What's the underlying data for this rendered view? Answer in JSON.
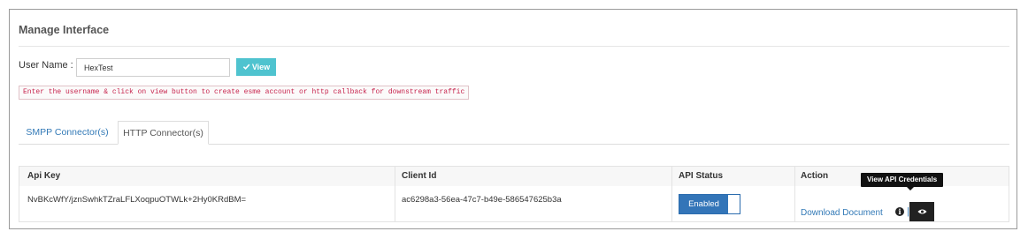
{
  "panel": {
    "title": "Manage Interface"
  },
  "form": {
    "user_label": "User Name :",
    "user_value": "HexTest",
    "view_label": "View",
    "hint": "Enter the username & click on view button to create esme account or http callback for downstream traffic"
  },
  "tabs": [
    {
      "label": "SMPP Connector(s)",
      "active": false
    },
    {
      "label": "HTTP Connector(s)",
      "active": true
    }
  ],
  "table": {
    "headers": [
      "Api Key",
      "Client Id",
      "API Status",
      "Action"
    ],
    "rows": [
      {
        "api_key": "NvBKcWfY/jznSwhkTZraLFLXoqpuOTWLk+2Hy0KRdBM=",
        "client_id": "ac6298a3-56ea-47c7-b49e-586547625b3a",
        "status_label": "Enabled",
        "download_label": "Download Document",
        "separator": "|"
      }
    ]
  },
  "tooltip": {
    "text": "View API Credentials"
  },
  "icons": {
    "view_button": "check-icon",
    "info": "info-icon",
    "credentials": "eye-icon"
  },
  "colors": {
    "view_button": "#4fc3cf",
    "toggle_on": "#3375b8",
    "link": "#337ab7",
    "hint_text": "#c7254e",
    "tooltip": "#111111"
  }
}
